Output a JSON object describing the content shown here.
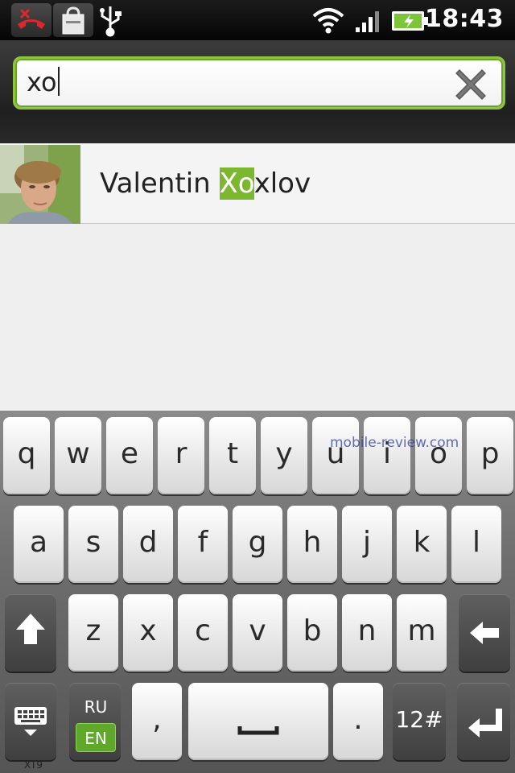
{
  "status_bar": {
    "time": "18:43",
    "icons": [
      "missed-call-icon",
      "shopping-bag-icon",
      "usb-icon",
      "wifi-icon",
      "signal-icon",
      "battery-charging-icon"
    ]
  },
  "search": {
    "query": "xo",
    "clear_icon": "clear-x-icon",
    "accent": "#8cc63f"
  },
  "results": [
    {
      "name_before": "Valentin ",
      "name_match": "Xo",
      "name_after": "xlov"
    }
  ],
  "keyboard": {
    "row1": [
      "q",
      "w",
      "e",
      "r",
      "t",
      "y",
      "u",
      "i",
      "o",
      "p"
    ],
    "row2": [
      "a",
      "s",
      "d",
      "f",
      "g",
      "h",
      "j",
      "k",
      "l"
    ],
    "row3": [
      "z",
      "x",
      "c",
      "v",
      "b",
      "n",
      "m"
    ],
    "lang_ru": "RU",
    "lang_en": "EN",
    "comma": ",",
    "period": ".",
    "numbers_label": "12#",
    "mode_label": "XT9",
    "watermark": "mobile-review.com",
    "highlight_color": "#7cb82f"
  }
}
